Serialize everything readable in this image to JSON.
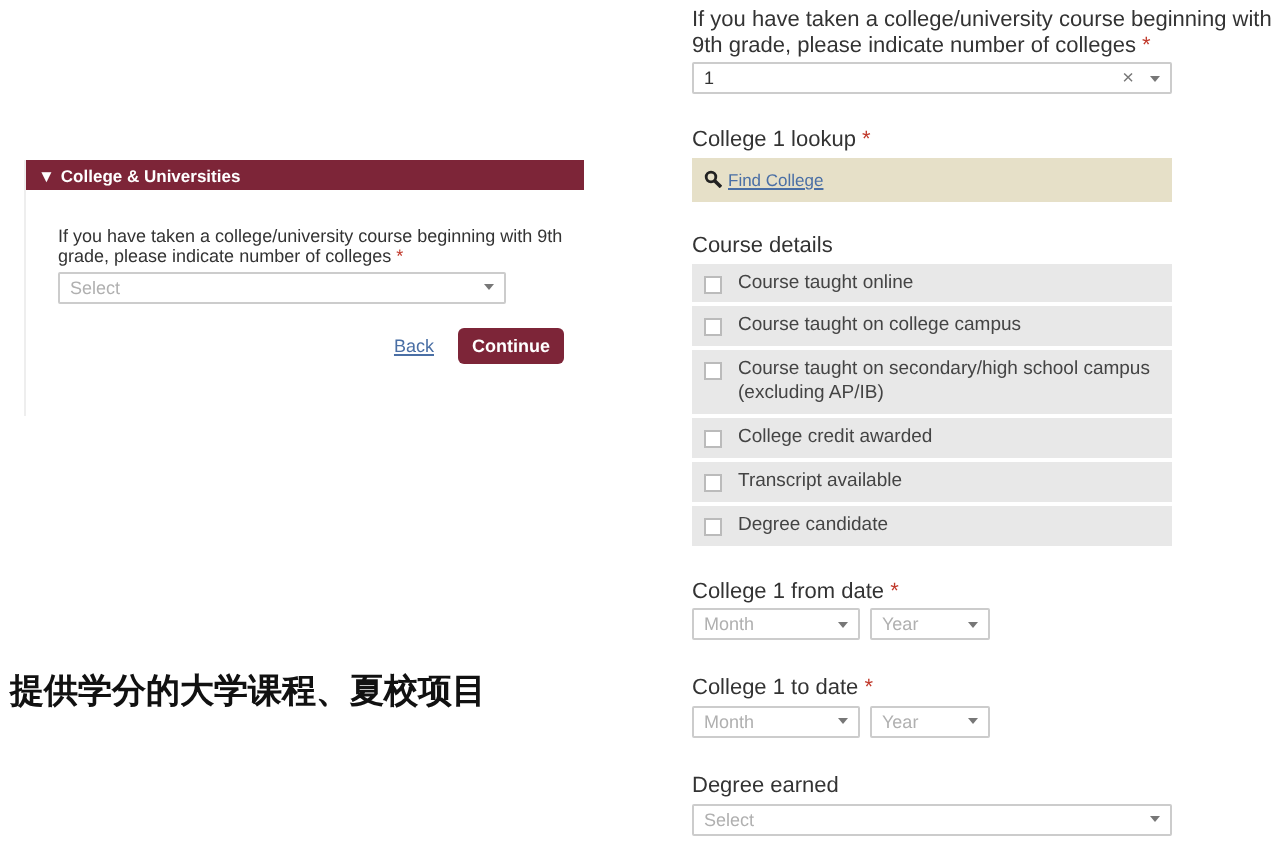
{
  "intro_panel": {
    "header": {
      "arrow": "▼",
      "title": "College & Universities"
    },
    "question": "If you have taken a college/university course beginning with 9th grade, please indicate number of colleges",
    "required_mark": "*",
    "select": {
      "placeholder": "Select"
    },
    "back_link": "Back",
    "continue_button": "Continue"
  },
  "caption": "提供学分的大学课程、夏校项目",
  "form": {
    "number_question": {
      "label": "If you have taken a college/university course beginning with 9th grade, please indicate number of colleges",
      "required_mark": "*",
      "select": {
        "value": "1",
        "clear": "×"
      }
    },
    "lookup": {
      "label": "College 1 lookup",
      "required_mark": "*",
      "link": "Find College"
    },
    "course_details": {
      "label": "Course details",
      "options": [
        {
          "label": "Course taught online",
          "checked": false
        },
        {
          "label": "Course taught on college campus",
          "checked": false
        },
        {
          "label": "Course taught on secondary/high school campus (excluding AP/IB)",
          "checked": false
        },
        {
          "label": "College credit awarded",
          "checked": false
        },
        {
          "label": "Transcript available",
          "checked": false
        },
        {
          "label": "Degree candidate",
          "checked": false
        }
      ]
    },
    "from_date": {
      "label": "College 1 from date",
      "required_mark": "*",
      "month": {
        "placeholder": "Month"
      },
      "year": {
        "placeholder": "Year"
      }
    },
    "to_date": {
      "label": "College 1 to date",
      "required_mark": "*",
      "month": {
        "placeholder": "Month"
      },
      "year": {
        "placeholder": "Year"
      }
    },
    "degree": {
      "label": "Degree earned",
      "select": {
        "placeholder": "Select"
      }
    }
  }
}
